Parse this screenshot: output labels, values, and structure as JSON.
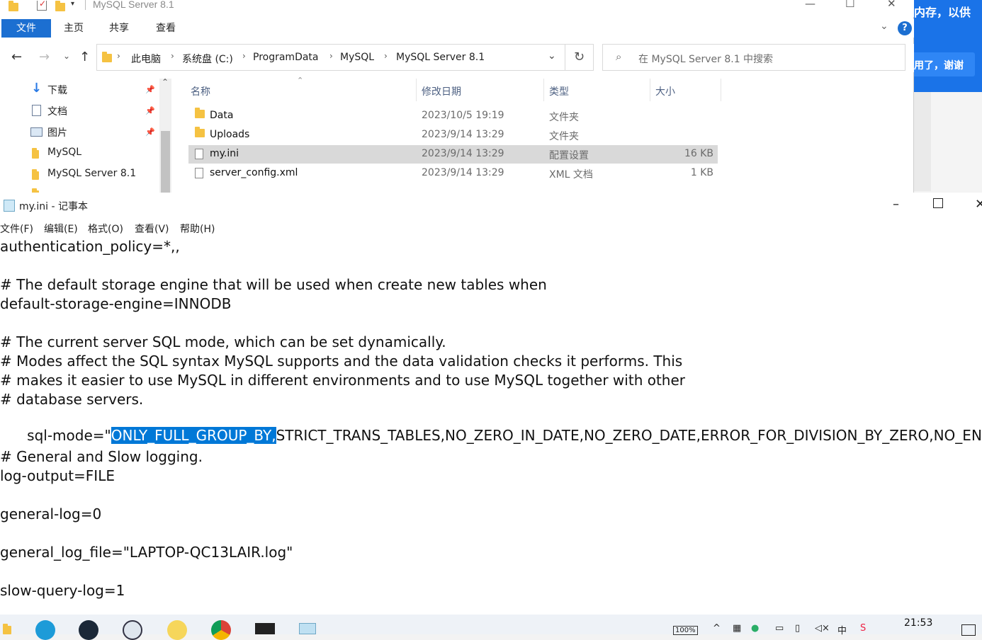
{
  "side_app": {
    "line1": "内存，以供",
    "line2": "用了，谢谢"
  },
  "explorer": {
    "title": "MySQL Server 8.1",
    "window_controls": {
      "minimize": "—",
      "maximize": "☐",
      "close": "✕"
    },
    "ribbon_tabs": [
      "文件",
      "主页",
      "共享",
      "查看"
    ],
    "breadcrumb": [
      "此电脑",
      "系统盘 (C:)",
      "ProgramData",
      "MySQL",
      "MySQL Server 8.1"
    ],
    "search_placeholder": "在 MySQL Server 8.1 中搜索",
    "nav_pane": [
      {
        "label": "下载",
        "icon": "download-icon",
        "pinned": true
      },
      {
        "label": "文档",
        "icon": "document-icon",
        "pinned": true
      },
      {
        "label": "图片",
        "icon": "picture-icon",
        "pinned": true
      },
      {
        "label": "MySQL",
        "icon": "folder-icon",
        "pinned": false
      },
      {
        "label": "MySQL Server 8.1",
        "icon": "folder-icon",
        "pinned": false
      }
    ],
    "columns": [
      "名称",
      "修改日期",
      "类型",
      "大小"
    ],
    "files": [
      {
        "name": "Data",
        "date": "2023/10/5 19:19",
        "type": "文件夹",
        "size": "",
        "icon": "folder-icon"
      },
      {
        "name": "Uploads",
        "date": "2023/9/14 13:29",
        "type": "文件夹",
        "size": "",
        "icon": "folder-icon"
      },
      {
        "name": "my.ini",
        "date": "2023/9/14 13:29",
        "type": "配置设置",
        "size": "16 KB",
        "icon": "config-file-icon",
        "selected": true
      },
      {
        "name": "server_config.xml",
        "date": "2023/9/14 13:29",
        "type": "XML 文档",
        "size": "1 KB",
        "icon": "file-icon"
      }
    ]
  },
  "notepad": {
    "title": "my.ini - 记事本",
    "menu": [
      "文件(F)",
      "编辑(E)",
      "格式(O)",
      "查看(V)",
      "帮助(H)"
    ],
    "lines": [
      "authentication_policy=*,,",
      "",
      "# The default storage engine that will be used when create new tables when",
      "default-storage-engine=INNODB",
      "",
      "# The current server SQL mode, which can be set dynamically.",
      "# Modes affect the SQL syntax MySQL supports and the data validation checks it performs. This",
      "# makes it easier to use MySQL in different environments and to use MySQL together with other",
      "# database servers.",
      "",
      "",
      "# General and Slow logging.",
      "log-output=FILE",
      "",
      "general-log=0",
      "",
      "general_log_file=\"LAPTOP-QC13LAIR.log\"",
      "",
      "slow-query-log=1"
    ],
    "sqlmode_prefix": "sql-mode=\"",
    "sqlmode_selected": "ONLY_FULL_GROUP_BY,",
    "sqlmode_rest": "STRICT_TRANS_TABLES,NO_ZERO_IN_DATE,NO_ZERO_DATE,ERROR_FOR_DIVISION_BY_ZERO,NO_ENGINE_SUB"
  },
  "taskbar": {
    "time": "21:53",
    "battery": "100%"
  }
}
